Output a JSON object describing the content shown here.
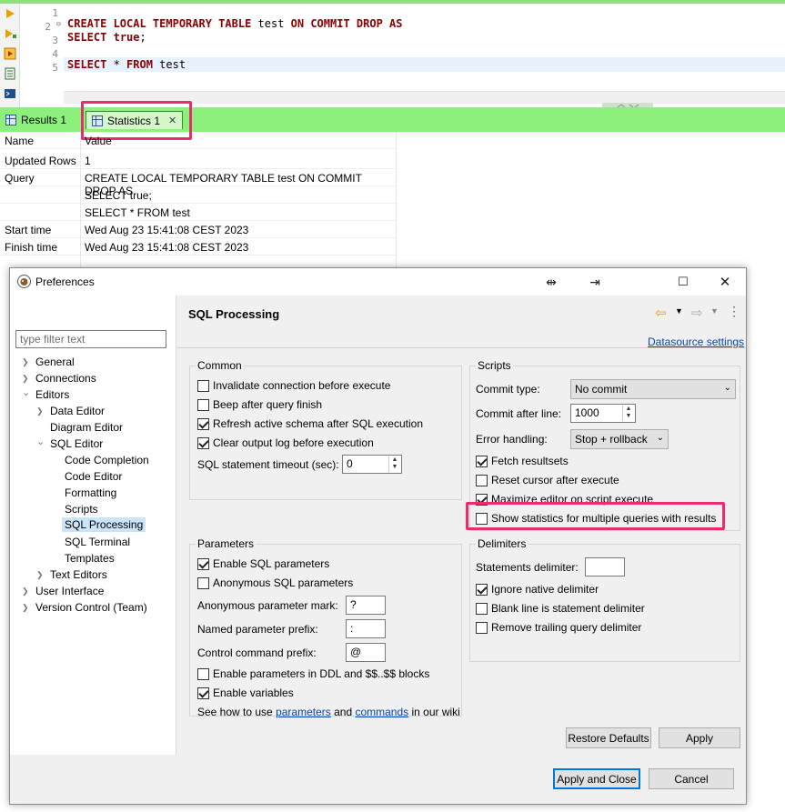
{
  "editor": {
    "lines": [
      {
        "num": "1",
        "text": ""
      },
      {
        "num": "2",
        "marker": "⊖",
        "kw1": "CREATE LOCAL TEMPORARY TABLE",
        "plain1": " test ",
        "kw2": "ON COMMIT DROP AS"
      },
      {
        "num": "3",
        "kw1": "SELECT",
        "plain1": " ",
        "kw2": "true",
        "plain2": ";"
      },
      {
        "num": "4",
        "text": ""
      },
      {
        "num": "5",
        "kw1": "SELECT",
        "plain1": " * ",
        "kw2": "FROM",
        "plain2": " test"
      }
    ]
  },
  "tabs": {
    "results": "Results 1",
    "statistics": "Statistics 1",
    "close": "✕"
  },
  "stats": {
    "header": {
      "name": "Name",
      "value": "Value"
    },
    "rows": [
      {
        "name": "Updated Rows",
        "value": "1"
      },
      {
        "name": "Query",
        "value": "CREATE LOCAL TEMPORARY TABLE test ON COMMIT DROP AS"
      },
      {
        "name": "",
        "value": "SELECT true;"
      },
      {
        "name": "",
        "value": "SELECT * FROM test"
      },
      {
        "name": "Start time",
        "value": "Wed Aug 23 15:41:08 CEST 2023"
      },
      {
        "name": "Finish time",
        "value": "Wed Aug 23 15:41:08 CEST 2023"
      }
    ]
  },
  "dialog": {
    "title": "Preferences",
    "filter_placeholder": "type filter text",
    "tree": [
      {
        "label": "General",
        "arrow": "❯"
      },
      {
        "label": "Connections",
        "arrow": "❯"
      },
      {
        "label": "Editors",
        "arrow": "⌄"
      },
      {
        "label": "Data Editor",
        "arrow": "❯"
      },
      {
        "label": "Diagram Editor"
      },
      {
        "label": "SQL Editor",
        "arrow": "⌄"
      },
      {
        "label": "Code Completion"
      },
      {
        "label": "Code Editor"
      },
      {
        "label": "Formatting"
      },
      {
        "label": "Scripts"
      },
      {
        "label": "SQL Processing"
      },
      {
        "label": "SQL Terminal"
      },
      {
        "label": "Templates"
      },
      {
        "label": "Text Editors",
        "arrow": "❯"
      },
      {
        "label": "User Interface",
        "arrow": "❯"
      },
      {
        "label": "Version Control (Team)",
        "arrow": "❯"
      }
    ],
    "page_title": "SQL Processing",
    "datasource_link": "Datasource settings",
    "common": {
      "title": "Common",
      "invalidate": "Invalidate connection before execute",
      "beep": "Beep after query finish",
      "refresh": "Refresh active schema after SQL execution",
      "clear_log": "Clear output log before execution",
      "timeout_label": "SQL statement timeout (sec):",
      "timeout_value": "0"
    },
    "scripts": {
      "title": "Scripts",
      "commit_type_label": "Commit type:",
      "commit_type_value": "No commit",
      "commit_after_label": "Commit after line:",
      "commit_after_value": "1000",
      "error_label": "Error handling:",
      "error_value": "Stop + rollback",
      "fetch": "Fetch resultsets",
      "reset_cursor": "Reset cursor after execute",
      "maximize": "Maximize editor on script execute",
      "show_stats": "Show statistics for multiple queries with results"
    },
    "parameters": {
      "title": "Parameters",
      "enable_sql": "Enable SQL parameters",
      "anon_sql": "Anonymous SQL parameters",
      "anon_mark_label": "Anonymous parameter mark:",
      "anon_mark_value": "?",
      "named_prefix_label": "Named parameter prefix:",
      "named_prefix_value": ":",
      "control_prefix_label": "Control command prefix:",
      "control_prefix_value": "@",
      "ddl_blocks": "Enable parameters in DDL and $$..$$ blocks",
      "enable_vars": "Enable variables",
      "see_how": "See how to use ",
      "link_parameters": "parameters",
      "and": " and ",
      "link_commands": "commands",
      "in_wiki": " in our wiki"
    },
    "delimiters": {
      "title": "Delimiters",
      "statements_label": "Statements delimiter:",
      "statements_value": "",
      "ignore_native": "Ignore native delimiter",
      "blank_line": "Blank line is statement delimiter",
      "remove_trailing": "Remove trailing query delimiter"
    },
    "buttons": {
      "restore": "Restore Defaults",
      "apply": "Apply",
      "apply_close": "Apply and Close",
      "cancel": "Cancel"
    }
  }
}
